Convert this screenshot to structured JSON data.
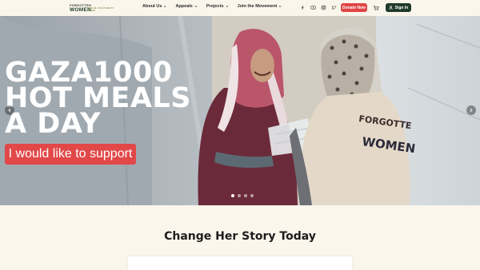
{
  "header": {
    "logo": {
      "top": "FORGOTTEN",
      "bottom": "WOMEN",
      "tagline": "SAVE ME. FOR WOMEN BY WOMEN"
    },
    "nav": [
      {
        "label": "About Us"
      },
      {
        "label": "Appeals"
      },
      {
        "label": "Projects"
      },
      {
        "label": "Join the Movement"
      }
    ],
    "donate_label": "Donate Now",
    "signin_label": "Sign In"
  },
  "hero": {
    "title_lines": [
      "GAZA1000",
      "HOT MEALS",
      "A DAY"
    ],
    "cta_label": "I would like to support",
    "vest_text": [
      "FORGOTTE",
      "WOMEN"
    ],
    "slides": 4,
    "active_slide": 1
  },
  "section": {
    "title": "Change Her Story Today"
  },
  "colors": {
    "brand_green": "#1f3b2a",
    "accent_red": "#e24848",
    "background": "#fbf6ec"
  },
  "icons": [
    "facebook-icon",
    "youtube-icon",
    "instagram-icon",
    "twitter-icon",
    "cart-icon",
    "user-icon",
    "chevron-down-icon",
    "chevron-left-icon",
    "chevron-right-icon"
  ]
}
